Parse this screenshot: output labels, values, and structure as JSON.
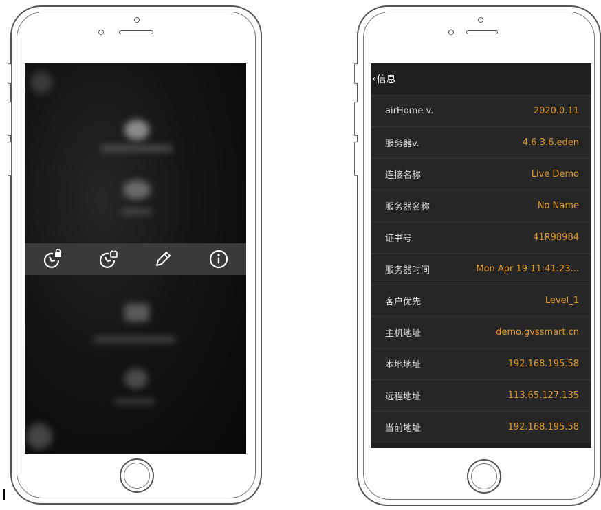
{
  "right_screen": {
    "nav": {
      "back_label": "信息"
    },
    "rows": [
      {
        "label": "airHome v.",
        "value": "2020.0.11"
      },
      {
        "label": "服务器v.",
        "value": "4.6.3.6.eden"
      },
      {
        "label": "连接名称",
        "value": "Live Demo"
      },
      {
        "label": "服务器名称",
        "value": "No Name"
      },
      {
        "label": "证书号",
        "value": "41R98984"
      },
      {
        "label": "服务器时间",
        "value": "Mon Apr 19 11:41:23..."
      },
      {
        "label": "客户优先",
        "value": "Level_1"
      },
      {
        "label": "主机地址",
        "value": "demo.gvssmart.cn"
      },
      {
        "label": "本地地址",
        "value": "192.168.195.58"
      },
      {
        "label": "远程地址",
        "value": "113.65.127.135"
      },
      {
        "label": "当前地址",
        "value": "192.168.195.58"
      }
    ]
  },
  "left_screen": {
    "toolbar_icons": [
      "timer-lock-icon",
      "timer-calendar-icon",
      "pencil-icon",
      "info-icon"
    ]
  },
  "colors": {
    "accent_value": "#e09a2a",
    "row_bg": "#262626",
    "toolbar_bg": "#3a3a3a"
  }
}
